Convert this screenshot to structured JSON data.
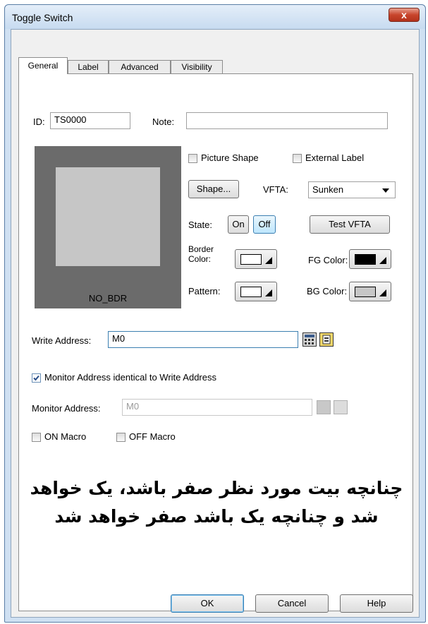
{
  "window": {
    "title": "Toggle Switch",
    "close_label": "x"
  },
  "tabs": [
    "General",
    "Label",
    "Advanced",
    "Visibility"
  ],
  "general": {
    "id_label": "ID:",
    "id_value": "TS0000",
    "note_label": "Note:",
    "note_value": "",
    "preview_label": "NO_BDR",
    "picture_shape_label": "Picture Shape",
    "external_label_label": "External Label",
    "shape_button": "Shape...",
    "vfta_label": "VFTA:",
    "vfta_value": "Sunken",
    "state_label": "State:",
    "state_on": "On",
    "state_off": "Off",
    "test_vfta_button": "Test VFTA",
    "border_color_label_1": "Border",
    "border_color_label_2": "Color:",
    "fg_color_label": "FG Color:",
    "pattern_label": "Pattern:",
    "bg_color_label": "BG Color:",
    "write_address_label": "Write Address:",
    "write_address_value": "M0",
    "monitor_identical_label": "Monitor Address identical to Write Address",
    "monitor_address_label": "Monitor Address:",
    "monitor_address_value": "M0",
    "on_macro_label": "ON Macro",
    "off_macro_label": "OFF Macro"
  },
  "annotation": {
    "line1": "چنانچه بیت مورد نظر صفر باشد، یک خواهد",
    "line2": "شد و چنانچه یک باشد صفر خواهد شد"
  },
  "footer": {
    "ok": "OK",
    "cancel": "Cancel",
    "help": "Help"
  },
  "colors": {
    "fg_color": "#000000",
    "bg_color": "#c6c6c6",
    "border_color": "#ffffff",
    "pattern_color": "#ffffff",
    "preview_outer": "#6b6b6b",
    "preview_inner": "#c6c6c6"
  },
  "state": {
    "monitor_identical_checked": true,
    "picture_shape_checked": false,
    "external_label_checked": false,
    "on_macro_checked": false,
    "off_macro_checked": false,
    "active_state": "Off"
  }
}
